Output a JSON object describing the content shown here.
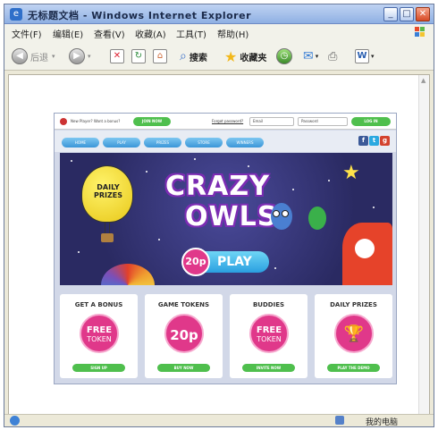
{
  "window": {
    "title": "无标题文档 - Windows Internet Explorer"
  },
  "menu": {
    "items": [
      "文件(F)",
      "编辑(E)",
      "查看(V)",
      "收藏(A)",
      "工具(T)",
      "帮助(H)"
    ]
  },
  "toolbar": {
    "back_label": "后退",
    "search_label": "搜索",
    "favorites_label": "收藏夹"
  },
  "status": {
    "zone": "我的电脑"
  },
  "site": {
    "topbar": {
      "new_player": "New Player? Want a bonus?",
      "join_now": "JOIN NOW",
      "forgot_password": "Forgot password?",
      "email_placeholder": "Email",
      "password_placeholder": "Password",
      "login": "LOG IN"
    },
    "nav": [
      "HOME",
      "PLAY",
      "PRIZES",
      "STORE",
      "WINNERS"
    ],
    "social_icons": [
      "facebook-icon",
      "twitter-icon",
      "googleplus-icon"
    ],
    "hero": {
      "balloon_text": "DAILY PRIZES",
      "title_line1": "CRAZY",
      "title_line2": "OWLS",
      "price": "20p",
      "play": "PLAY"
    },
    "cards": [
      {
        "title": "GET A BONUS",
        "circle_top": "FREE",
        "circle_bottom": "TOKEN",
        "button": "SIGN UP"
      },
      {
        "title": "GAME TOKENS",
        "circle_amount": "20p",
        "button": "BUY NOW"
      },
      {
        "title": "BUDDIES",
        "circle_top": "FREE",
        "circle_bottom": "TOKEN",
        "button": "INVITE NOW"
      },
      {
        "title": "DAILY PRIZES",
        "circle_icon": "trophy-icon",
        "button": "PLAY THE DEMO"
      }
    ]
  }
}
